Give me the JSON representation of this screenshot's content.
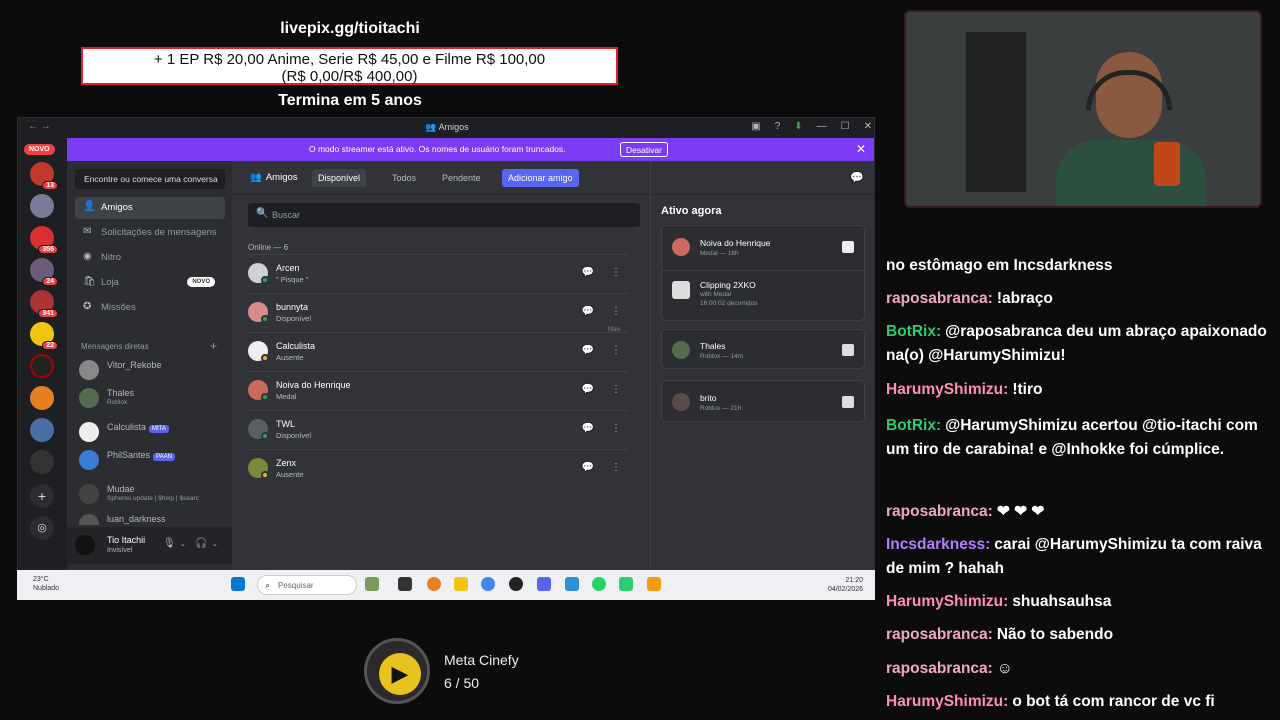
{
  "overlay": {
    "donation_url": "livepix.gg/tioitachi",
    "donation_line1": "+ 1 EP R$ 20,00 Anime, Serie R$ 45,00 e Filme R$ 100,00",
    "donation_line2": "(R$ 0,00/R$ 400,00)",
    "donation_end": "Termina em 5 anos",
    "goal_title": "Meta Cinefy",
    "goal_count": "6 / 50"
  },
  "window": {
    "title": "Amigos"
  },
  "servers": [
    {
      "badge": "NOVO"
    },
    {
      "badge": "13"
    },
    {
      "badge": ""
    },
    {
      "badge": "356"
    },
    {
      "badge": "24"
    },
    {
      "badge": "341"
    },
    {
      "badge": "22"
    },
    {
      "badge": ""
    },
    {
      "badge": ""
    },
    {
      "badge": ""
    },
    {
      "badge": ""
    }
  ],
  "banner": {
    "text": "O modo streamer está ativo. Os nomes de usuário foram truncados.",
    "button": "Desativar"
  },
  "sidebar": {
    "search": "Encontre ou comece uma conversa",
    "items": [
      {
        "label": "Amigos"
      },
      {
        "label": "Solicitações de mensagens"
      },
      {
        "label": "Nitro"
      },
      {
        "label": "Loja",
        "badge": "NOVO"
      },
      {
        "label": "Missões"
      }
    ],
    "dm_header": "Mensagens diretas",
    "dms": [
      {
        "name": "Vitor_Rekobe",
        "sub": "",
        "tag": ""
      },
      {
        "name": "Thales",
        "sub": "Roblox",
        "tag": ""
      },
      {
        "name": "Calculista",
        "sub": "",
        "tag": "MITA"
      },
      {
        "name": "PhilSantes",
        "sub": "",
        "tag": "PAAN"
      },
      {
        "name": "Mudae",
        "sub": "Spheres update | $help | $searc",
        "tag": ""
      },
      {
        "name": "luan_darkness",
        "sub": "",
        "tag": ""
      }
    ]
  },
  "user": {
    "name": "Tio Itachii",
    "status": "Invisível"
  },
  "topbar": {
    "title": "Amigos",
    "tabs": [
      "Disponível",
      "Todos",
      "Pendente",
      "Adicionar amigo"
    ]
  },
  "friends": {
    "search_placeholder": "Buscar",
    "online_count": "Online — 6",
    "more_label": "Mais",
    "list": [
      {
        "name": "Arcen",
        "status": "\" Pisque \"",
        "color": "#cfcfd6"
      },
      {
        "name": "bunnyta",
        "status": "Disponível",
        "color": "#d98b8b"
      },
      {
        "name": "Calculista",
        "status": "Ausente",
        "color": "#eeeeee"
      },
      {
        "name": "Noiva do Henrique",
        "status": "Medal",
        "color": "#c96b5c"
      },
      {
        "name": "TWL",
        "status": "Disponível",
        "color": "#5a5f66"
      },
      {
        "name": "Zenx",
        "status": "Ausente",
        "color": "#7a8a3a"
      }
    ]
  },
  "active_now": {
    "title": "Ativo agora",
    "cards": [
      {
        "name": "Noiva do Henrique",
        "status": "Medal — 16h",
        "extra_name": "Clipping 2XKO",
        "extra_sub1": "with Medal",
        "extra_sub2": "16:00:02 decorridos"
      },
      {
        "name": "Thales",
        "status": "Roblox — 14m"
      },
      {
        "name": "brito",
        "status": "Roblox — 21h"
      }
    ]
  },
  "taskbar": {
    "temp": "23°C",
    "weather": "Nublado",
    "search": "Pesquisar",
    "time": "21:20",
    "date": "04/02/2026"
  },
  "chat": [
    {
      "user": "",
      "user_color": "#ffffff",
      "text": "no estômago em Incsdarkness"
    },
    {
      "user": "raposabranca:",
      "user_color": "#f0a8c0",
      "text": "!abraço"
    },
    {
      "user": "BotRix:",
      "user_color": "#2ecc71",
      "text": "@raposabranca deu um abraço apaixonado na(o) @HarumyShimizu!"
    },
    {
      "user": "HarumyShimizu:",
      "user_color": "#ff8fb0",
      "text": "!tiro"
    },
    {
      "user": "BotRix:",
      "user_color": "#2ecc71",
      "text": "@HarumyShimizu acertou @tio-itachi com um tiro de carabina! e @Inhokke foi cúmplice."
    },
    {
      "user": "raposabranca:",
      "user_color": "#f0a8c0",
      "text": "❤ ❤ ❤"
    },
    {
      "user": "Incsdarkness:",
      "user_color": "#b57cff",
      "text": "carai @HarumyShimizu ta com raiva de mim ? hahah"
    },
    {
      "user": "HarumyShimizu:",
      "user_color": "#ff8fb0",
      "text": "shuahsauhsa"
    },
    {
      "user": "raposabranca:",
      "user_color": "#f0a8c0",
      "text": "Não to sabendo"
    },
    {
      "user": "raposabranca:",
      "user_color": "#f0a8c0",
      "text": "☺"
    },
    {
      "user": "HarumyShimizu:",
      "user_color": "#ff8fb0",
      "text": "o bot tá com rancor de vc fi"
    }
  ]
}
